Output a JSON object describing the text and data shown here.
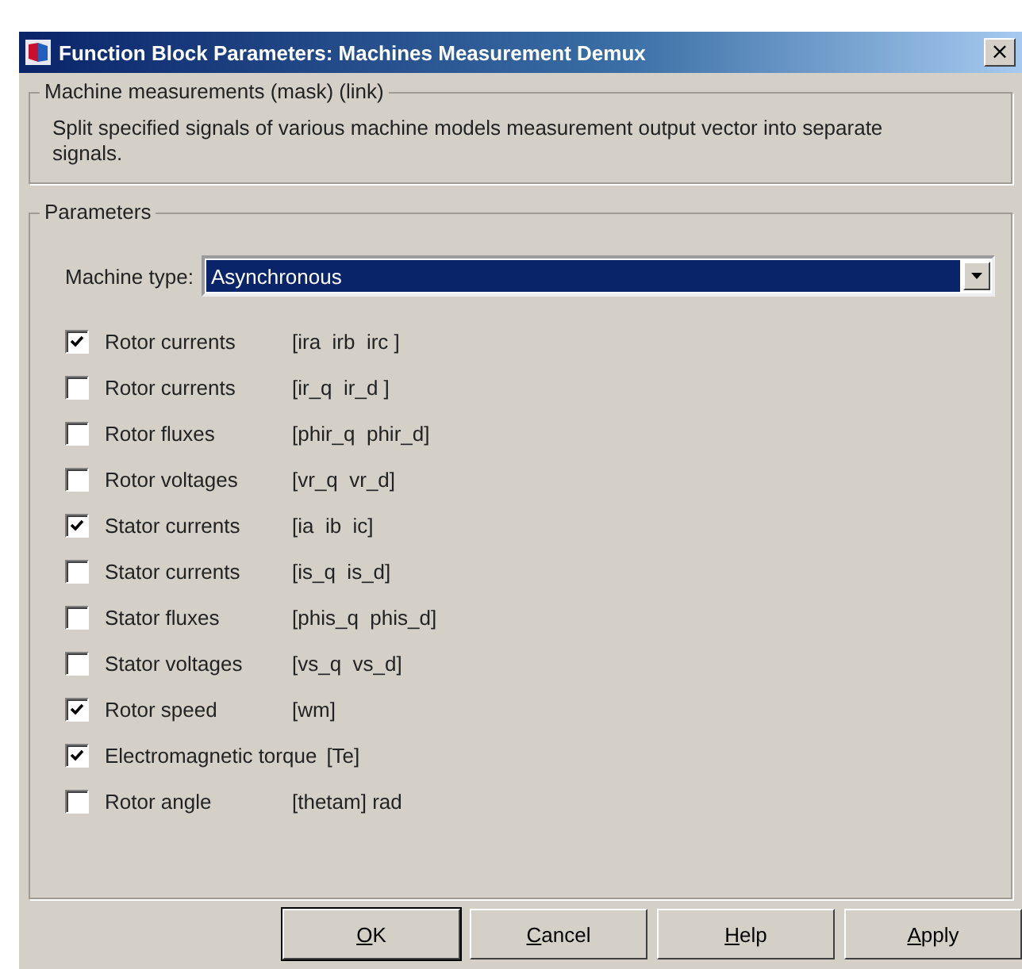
{
  "window": {
    "title": "Function Block Parameters: Machines Measurement Demux",
    "close": "×"
  },
  "mask_group": {
    "title": "Machine measurements (mask) (link)",
    "description": "Split specified signals of various machine models measurement output vector into separate signals."
  },
  "parameters": {
    "title": "Parameters",
    "machine_type": {
      "label": "Machine type:",
      "value": "Asynchronous",
      "selected": true
    },
    "signals": [
      {
        "label": "Rotor currents",
        "signals": "[ira  irb  irc ]",
        "checked": true
      },
      {
        "label": "Rotor currents",
        "signals": "[ir_q  ir_d ]",
        "checked": false
      },
      {
        "label": "Rotor fluxes",
        "signals": "[phir_q  phir_d]",
        "checked": false
      },
      {
        "label": "Rotor voltages",
        "signals": "[vr_q  vr_d]",
        "checked": false
      },
      {
        "label": "Stator currents",
        "signals": "[ia  ib  ic]",
        "checked": true
      },
      {
        "label": "Stator currents",
        "signals": "[is_q  is_d]",
        "checked": false
      },
      {
        "label": "Stator fluxes",
        "signals": "[phis_q  phis_d]",
        "checked": false
      },
      {
        "label": "Stator voltages",
        "signals": "[vs_q  vs_d]",
        "checked": false
      },
      {
        "label": "Rotor speed",
        "signals": "[wm]",
        "checked": true
      },
      {
        "label": "Electromagnetic torque",
        "signals": "[Te]",
        "checked": true
      },
      {
        "label": "Rotor angle",
        "signals": "[thetam] rad",
        "checked": false
      }
    ]
  },
  "buttons": [
    {
      "label": "OK",
      "default": true
    },
    {
      "label": "Cancel",
      "default": false
    },
    {
      "label": "Help",
      "default": false
    },
    {
      "label": "Apply",
      "default": false
    }
  ]
}
